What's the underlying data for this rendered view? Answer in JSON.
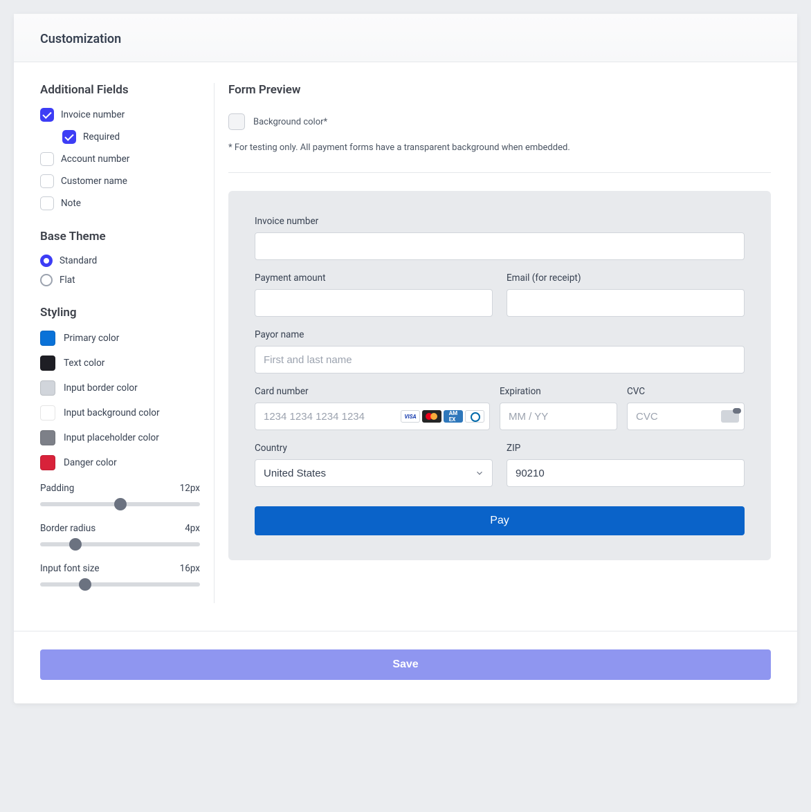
{
  "header": {
    "title": "Customization"
  },
  "sidebar": {
    "additional_fields": {
      "title": "Additional Fields",
      "items": [
        {
          "label": "Invoice number",
          "checked": true
        },
        {
          "label": "Required",
          "checked": true,
          "indent": true
        },
        {
          "label": "Account number",
          "checked": false
        },
        {
          "label": "Customer name",
          "checked": false
        },
        {
          "label": "Note",
          "checked": false
        }
      ]
    },
    "base_theme": {
      "title": "Base Theme",
      "options": [
        {
          "label": "Standard",
          "selected": true
        },
        {
          "label": "Flat",
          "selected": false
        }
      ]
    },
    "styling": {
      "title": "Styling",
      "colors": [
        {
          "label": "Primary color",
          "hex": "#0a72d8"
        },
        {
          "label": "Text color",
          "hex": "#1e1e24"
        },
        {
          "label": "Input border color",
          "hex": "#d1d5db"
        },
        {
          "label": "Input background color",
          "hex": "#ffffff"
        },
        {
          "label": "Input placeholder color",
          "hex": "#7d8088"
        },
        {
          "label": "Danger color",
          "hex": "#d8223a"
        }
      ],
      "sliders": [
        {
          "label": "Padding",
          "value": "12px",
          "pos": 50
        },
        {
          "label": "Border radius",
          "value": "4px",
          "pos": 22
        },
        {
          "label": "Input font size",
          "value": "16px",
          "pos": 28
        }
      ]
    }
  },
  "main": {
    "title": "Form Preview",
    "bg_color_label": "Background color*",
    "note": "* For testing only. All payment forms have a transparent background when embedded.",
    "form": {
      "invoice_label": "Invoice number",
      "amount_label": "Payment amount",
      "email_label": "Email (for receipt)",
      "payor_label": "Payor name",
      "payor_placeholder": "First and last name",
      "card_label": "Card number",
      "card_placeholder": "1234 1234 1234 1234",
      "exp_label": "Expiration",
      "exp_placeholder": "MM / YY",
      "cvc_label": "CVC",
      "cvc_placeholder": "CVC",
      "country_label": "Country",
      "country_value": "United States",
      "zip_label": "ZIP",
      "zip_value": "90210",
      "pay_label": "Pay"
    }
  },
  "footer": {
    "save_label": "Save"
  }
}
